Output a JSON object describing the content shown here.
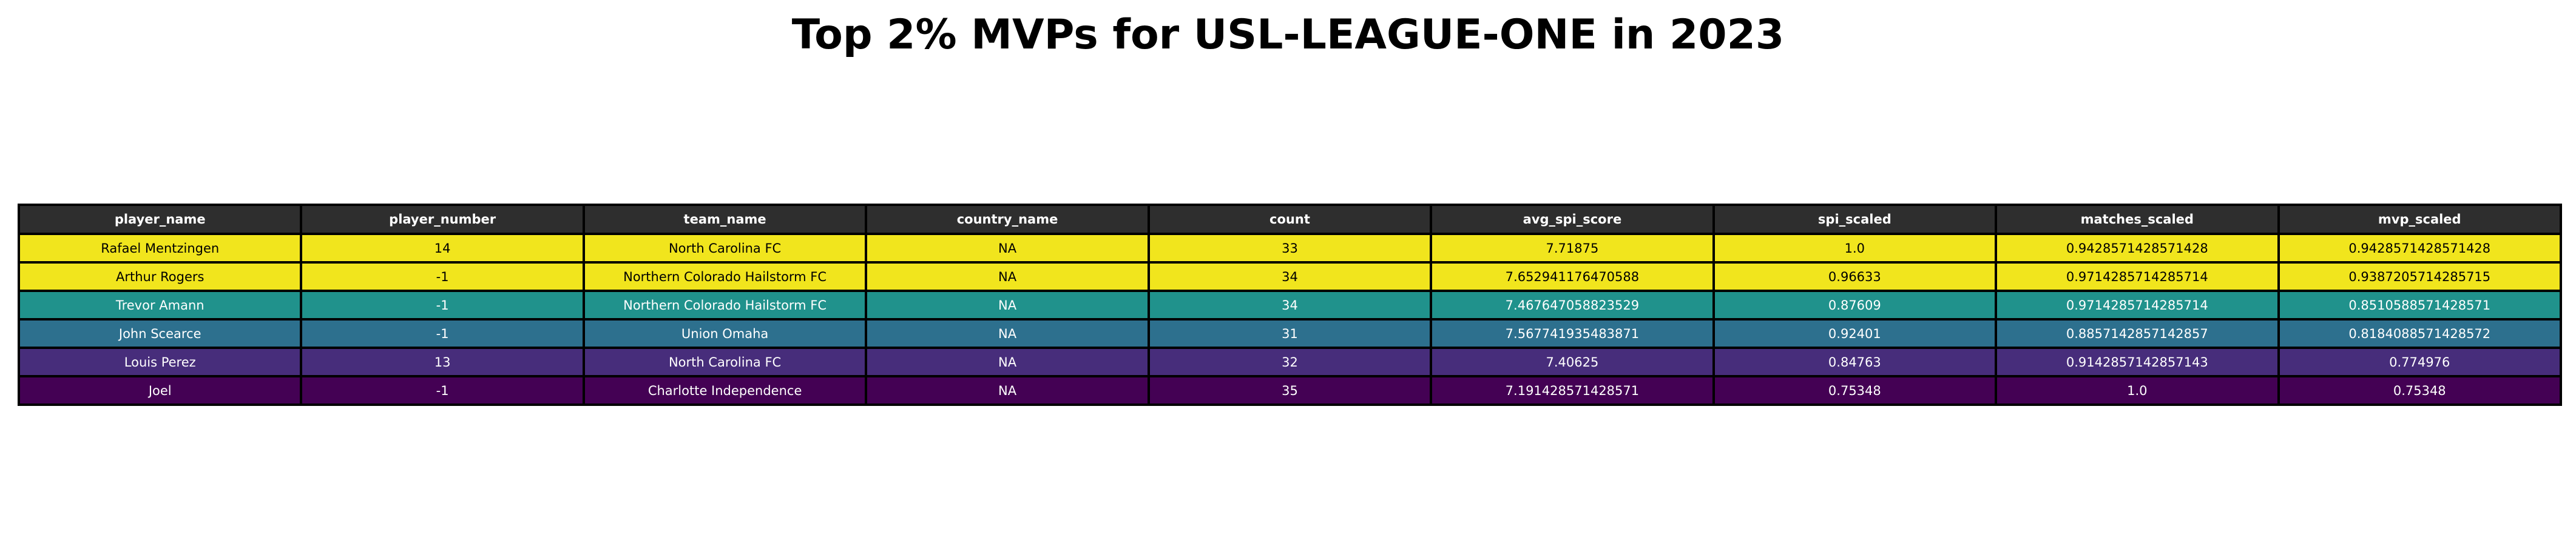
{
  "title": "Top 2% MVPs for USL-LEAGUE-ONE in 2023",
  "colors": {
    "header_bg": "#2e2e2e",
    "header_text": "#ffffff",
    "border": "#000000"
  },
  "chart_data": {
    "type": "table",
    "title": "Top 2% MVPs for USL-LEAGUE-ONE in 2023",
    "columns": [
      "player_name",
      "player_number",
      "team_name",
      "country_name",
      "count",
      "avg_spi_score",
      "spi_scaled",
      "matches_scaled",
      "mvp_scaled"
    ],
    "rows": [
      {
        "cells": [
          "Rafael Mentzingen",
          "14",
          "North Carolina FC",
          "NA",
          "33",
          "7.71875",
          "1.0",
          "0.9428571428571428",
          "0.9428571428571428"
        ],
        "bg": "#f1e51d",
        "fg": "#000000"
      },
      {
        "cells": [
          "Arthur Rogers",
          "-1",
          "Northern Colorado Hailstorm FC",
          "NA",
          "34",
          "7.652941176470588",
          "0.96633",
          "0.9714285714285714",
          "0.9387205714285715"
        ],
        "bg": "#f1e51d",
        "fg": "#000000"
      },
      {
        "cells": [
          "Trevor Amann",
          "-1",
          "Northern Colorado Hailstorm FC",
          "NA",
          "34",
          "7.467647058823529",
          "0.87609",
          "0.9714285714285714",
          "0.8510588571428571"
        ],
        "bg": "#20928c",
        "fg": "#ffffff"
      },
      {
        "cells": [
          "John Scearce",
          "-1",
          "Union Omaha",
          "NA",
          "31",
          "7.567741935483871",
          "0.92401",
          "0.8857142857142857",
          "0.8184088571428572"
        ],
        "bg": "#2d708e",
        "fg": "#ffffff"
      },
      {
        "cells": [
          "Louis Perez",
          "13",
          "North Carolina FC",
          "NA",
          "32",
          "7.40625",
          "0.84763",
          "0.9142857142857143",
          "0.774976"
        ],
        "bg": "#472d7b",
        "fg": "#ffffff"
      },
      {
        "cells": [
          "Joel",
          "-1",
          "Charlotte Independence",
          "NA",
          "35",
          "7.191428571428571",
          "0.75348",
          "1.0",
          "0.75348"
        ],
        "bg": "#440154",
        "fg": "#ffffff"
      }
    ]
  }
}
